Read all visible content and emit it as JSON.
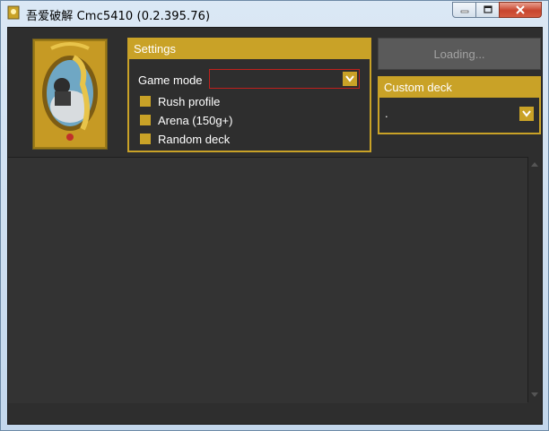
{
  "window": {
    "title": "吾爱破解 Cmc5410 (0.2.395.76)"
  },
  "settings": {
    "header": "Settings",
    "game_mode_label": "Game mode",
    "game_mode_value": "",
    "checkboxes": [
      {
        "label": "Rush profile"
      },
      {
        "label": "Arena (150g+)"
      },
      {
        "label": "Random deck"
      }
    ]
  },
  "loading_button": {
    "label": "Loading..."
  },
  "custom_deck": {
    "header": "Custom deck",
    "value": "."
  },
  "colors": {
    "accent": "#c9a227",
    "background": "#2e2e2e",
    "error_border": "#c0201c"
  }
}
